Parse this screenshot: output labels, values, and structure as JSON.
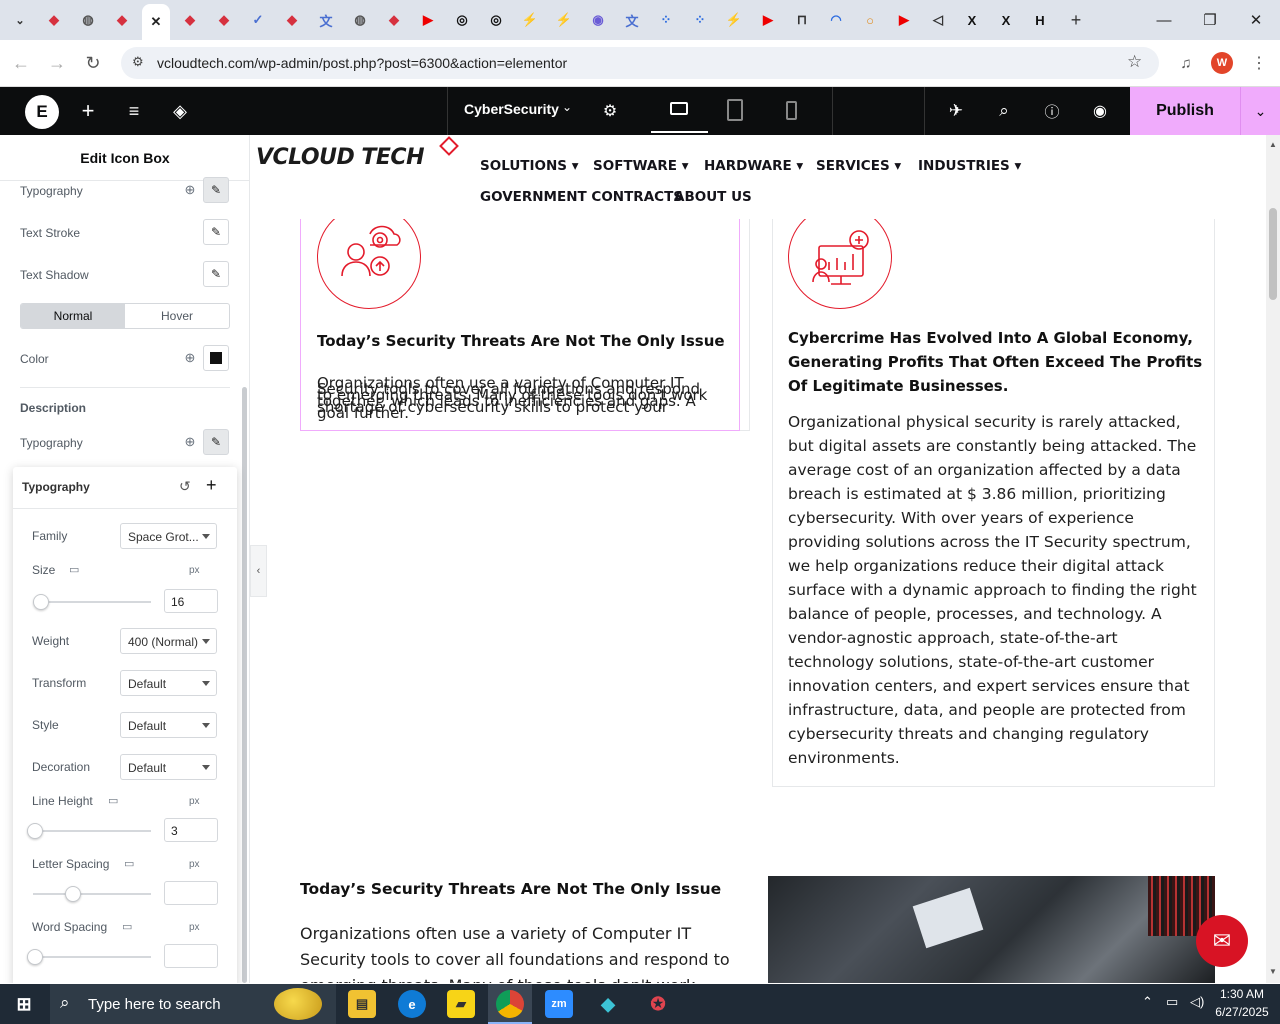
{
  "browser": {
    "url": "vcloudtech.com/wp-admin/post.php?post=6300&action=elementor",
    "new_tab": "+",
    "tabs": [
      {
        "icon": "vivaldi-icon",
        "color": "#d6313f"
      },
      {
        "icon": "globe-icon",
        "color": "#555"
      },
      {
        "icon": "vivaldi-icon",
        "color": "#d6313f"
      },
      {
        "icon": "close-icon",
        "color": "#222"
      },
      {
        "icon": "vivaldi-icon",
        "color": "#d6313f"
      },
      {
        "icon": "vivaldi-icon",
        "color": "#d6313f"
      },
      {
        "icon": "check-icon",
        "color": "#4a6fd1"
      },
      {
        "icon": "vivaldi-icon",
        "color": "#d6313f"
      },
      {
        "icon": "translate-icon",
        "color": "#4a6fd1"
      },
      {
        "icon": "globe-icon",
        "color": "#555"
      },
      {
        "icon": "vivaldi-icon",
        "color": "#d6313f"
      },
      {
        "icon": "youtube-icon",
        "color": "#e00"
      },
      {
        "icon": "openai-icon",
        "color": "#111"
      },
      {
        "icon": "openai-icon",
        "color": "#111"
      },
      {
        "icon": "bolt-icon",
        "color": "#2aa84a"
      },
      {
        "icon": "bolt-icon",
        "color": "#2aa84a"
      },
      {
        "icon": "chrome-icon",
        "color": "#6a5cd6"
      },
      {
        "icon": "translate-icon",
        "color": "#4a6fd1"
      },
      {
        "icon": "dots-icon",
        "color": "#2b6be0"
      },
      {
        "icon": "dots-icon",
        "color": "#2b6be0"
      },
      {
        "icon": "bolt-icon",
        "color": "#2aa84a"
      },
      {
        "icon": "youtube-icon",
        "color": "#e00"
      },
      {
        "icon": "lock-icon",
        "color": "#333"
      },
      {
        "icon": "wifi-icon",
        "color": "#2b6be0"
      },
      {
        "icon": "circle-icon",
        "color": "#e08a1a"
      },
      {
        "icon": "youtube-icon",
        "color": "#e00"
      },
      {
        "icon": "speaker-icon",
        "color": "#333"
      },
      {
        "icon": "x-icon",
        "color": "#111"
      },
      {
        "icon": "x-icon",
        "color": "#111"
      },
      {
        "icon": "h-icon",
        "color": "#111"
      }
    ],
    "profile_initial": "W"
  },
  "elementor_bar": {
    "page_name": "CyberSecurity",
    "publish_label": "Publish"
  },
  "panel": {
    "title": "Edit Icon Box",
    "typography_label": "Typography",
    "text_stroke_label": "Text Stroke",
    "text_shadow_label": "Text Shadow",
    "tab_normal": "Normal",
    "tab_hover": "Hover",
    "color_label": "Color",
    "description_heading": "Description",
    "desc_typography_label": "Typography",
    "popover": {
      "title": "Typography",
      "family_label": "Family",
      "family_value": "Space Grot...",
      "size_label": "Size",
      "size_unit": "px",
      "size_value": "16",
      "weight_label": "Weight",
      "weight_value": "400 (Normal)",
      "transform_label": "Transform",
      "transform_value": "Default",
      "style_label": "Style",
      "style_value": "Default",
      "decoration_label": "Decoration",
      "decoration_value": "Default",
      "line_height_label": "Line Height",
      "line_height_unit": "px",
      "line_height_value": "3",
      "letter_spacing_label": "Letter Spacing",
      "letter_spacing_unit": "px",
      "letter_spacing_value": "",
      "word_spacing_label": "Word Spacing",
      "word_spacing_unit": "px",
      "word_spacing_value": ""
    }
  },
  "site": {
    "logo_text": "VCLOUD TECH",
    "menu": [
      "SOLUTIONS",
      "SOFTWARE",
      "HARDWARE",
      "SERVICES",
      "INDUSTRIES"
    ],
    "menu2": [
      "GOVERNMENT CONTRACTS",
      "ABOUT US"
    ],
    "card1": {
      "title": "Today’s Security Threats Are Not The Only Issue",
      "lines": [
        "Organizations often use a variety of Computer IT",
        "Security tools to cover all foundations and respond",
        "to emerging threats. Many of these tools don't work",
        "together, which leads to inefficiencies and gaps. A",
        "shortage of cybersecurity skills to protect your",
        "goal further."
      ]
    },
    "card2": {
      "title": "Cybercrime Has Evolved Into A Global Economy, Generating Profits That Often Exceed The Profits Of Legitimate Businesses.",
      "body": "Organizational physical security is rarely attacked, but digital assets are constantly being attacked. The average cost of an organization affected by a data breach is estimated at $ 3.86 million, prioritizing cybersecurity. With over years of experience providing solutions across the IT Security spectrum, we help organizations reduce their digital attack surface with a dynamic approach to finding the right balance of people, processes, and technology. A vendor-agnostic approach, state-of-the-art technology solutions, state-of-the-art customer innovation centers, and expert services ensure that infrastructure, data, and people are protected from cybersecurity threats and changing regulatory environments."
    },
    "section2": {
      "title": "Today’s Security Threats Are Not The Only Issue",
      "body": "Organizations often use a variety of Computer IT Security tools to cover all foundations and respond to emerging threats. Many of these tools don't work together"
    }
  },
  "taskbar": {
    "search_placeholder": "Type here to search",
    "time": "1:30 AM",
    "date": "6/27/2025"
  },
  "colors": {
    "accent_pink": "#f0abfc",
    "brand_red": "#e31b2b",
    "taskbar": "#1f2a36"
  }
}
